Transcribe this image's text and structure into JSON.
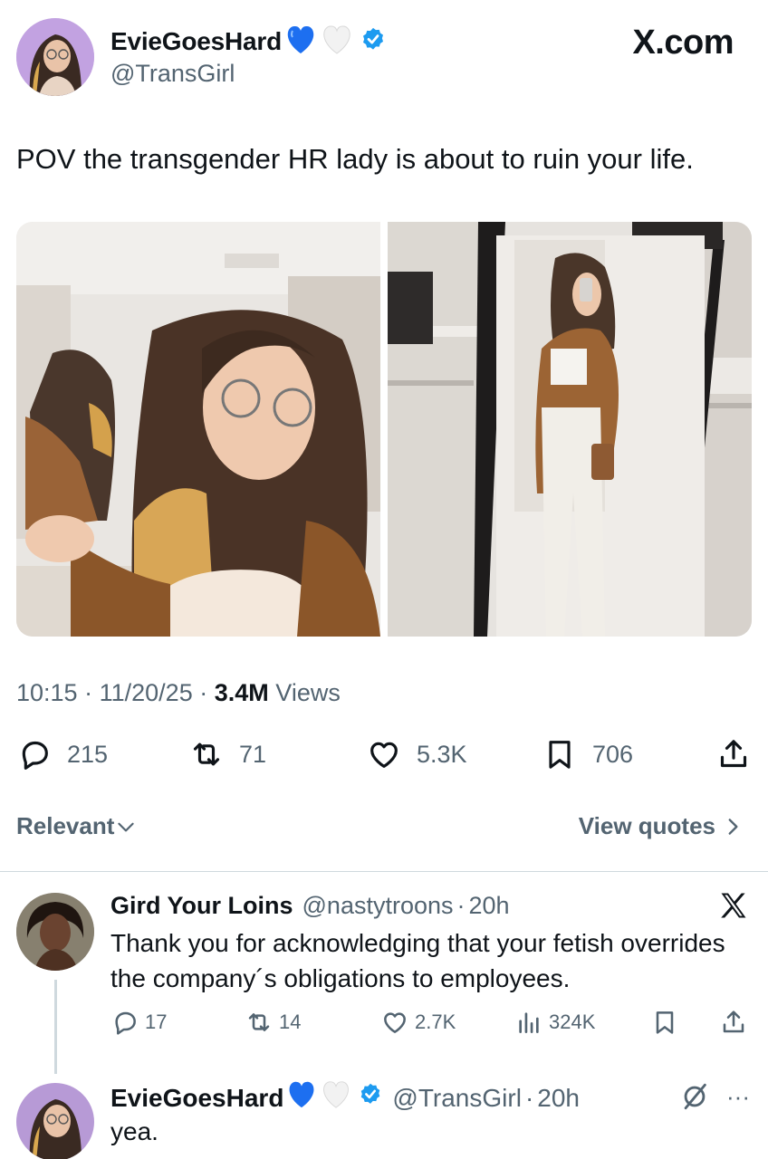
{
  "author": {
    "display_name": "EvieGoesHard",
    "handle": "@TransGirl",
    "emojis": [
      "blue-heart-icon",
      "white-heart-icon"
    ],
    "verified": true
  },
  "brand": {
    "label": "X.com"
  },
  "tweet": {
    "text": "POV the transgender HR lady is about to ruin your life.",
    "time": "10:15",
    "date": "11/20/25",
    "views_count": "3.4M",
    "views_label": "Views",
    "dot": "·"
  },
  "actions": {
    "replies": "215",
    "reposts": "71",
    "likes": "5.3K",
    "bookmarks": "706"
  },
  "filter": {
    "sort_label": "Relevant",
    "view_quotes_label": "View quotes"
  },
  "reply": {
    "display_name": "Gird Your Loins",
    "handle": "@nastytroons",
    "time": "20h",
    "text": "Thank you for acknowledging that your fetish overrides the company´s obligations to employees.",
    "replies": "17",
    "reposts": "14",
    "likes": "2.7K",
    "views": "324K"
  },
  "reply2": {
    "display_name": "EvieGoesHard",
    "handle": "@TransGirl",
    "time": "20h",
    "text": "yea.",
    "more": "···"
  },
  "colors": {
    "text": "#0f1419",
    "secondary": "#536471",
    "verified": "#1d9bf0",
    "divider": "#cfd9de"
  }
}
